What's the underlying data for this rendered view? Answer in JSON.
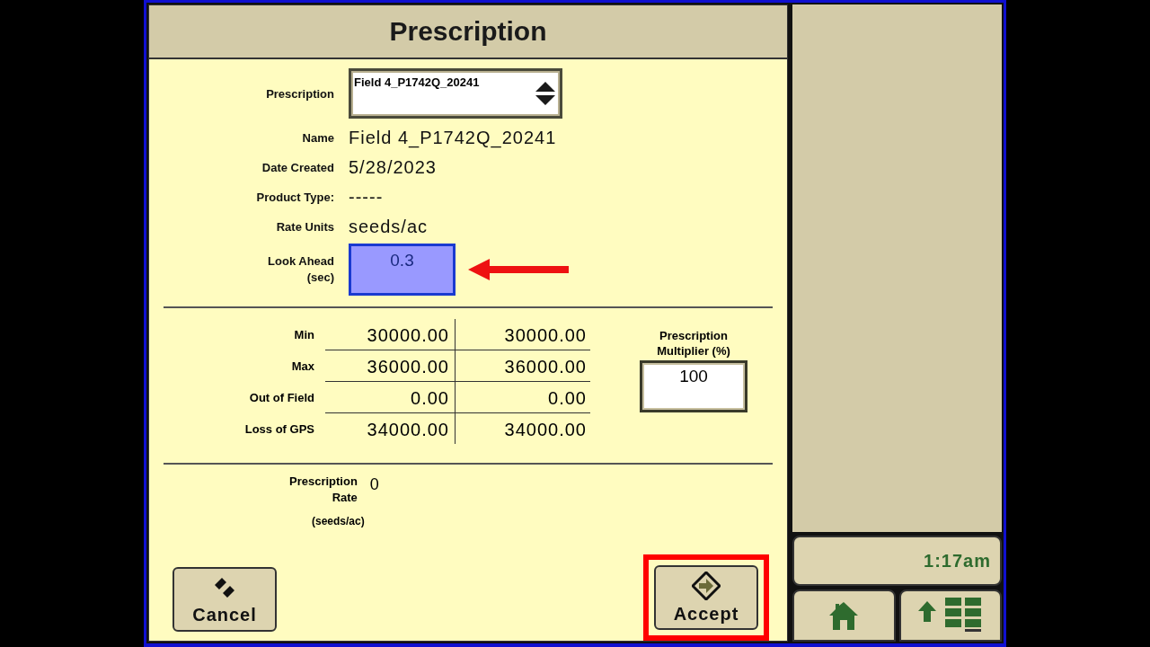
{
  "title": "Prescription",
  "prescription": {
    "label": "Prescription",
    "value": "Field 4_P1742Q_20241"
  },
  "details": [
    {
      "label": "Name",
      "value": "Field 4_P1742Q_20241"
    },
    {
      "label": "Date Created",
      "value": "5/28/2023"
    },
    {
      "label": "Product Type:",
      "value": "-----"
    },
    {
      "label": "Rate Units",
      "value": "seeds/ac"
    }
  ],
  "look_ahead": {
    "label": "Look Ahead",
    "unit": "(sec)",
    "value": "0.3"
  },
  "rates": [
    {
      "label": "Min",
      "values": [
        "30000.00",
        "30000.00"
      ]
    },
    {
      "label": "Max",
      "values": [
        "36000.00",
        "36000.00"
      ]
    },
    {
      "label": "Out of Field",
      "values": [
        "0.00",
        "0.00"
      ]
    },
    {
      "label": "Loss of GPS",
      "values": [
        "34000.00",
        "34000.00"
      ]
    }
  ],
  "multiplier": {
    "label_lines": [
      "Prescription",
      "Multiplier (%)"
    ],
    "value": "100"
  },
  "prescription_rate": {
    "label_lines": [
      "Prescription",
      "Rate"
    ],
    "value": "0",
    "units": "(seeds/ac)"
  },
  "buttons": [
    {
      "kind": "cancel",
      "label": "Cancel",
      "highlighted": false
    },
    {
      "kind": "accept",
      "label": "Accept",
      "highlighted": true
    }
  ],
  "clock": "1:17am"
}
